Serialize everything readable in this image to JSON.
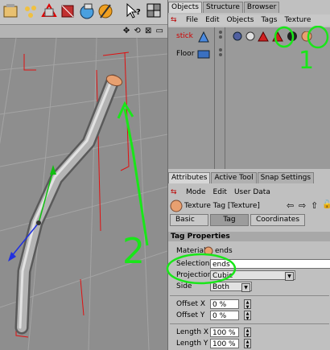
{
  "objects_panel": {
    "tabs": [
      "Objects",
      "Structure",
      "Browser"
    ],
    "menu": [
      "File",
      "Edit",
      "Objects",
      "Tags",
      "Texture"
    ],
    "items": [
      {
        "name": "stick"
      },
      {
        "name": "Floor"
      }
    ]
  },
  "attributes_panel": {
    "tabs": [
      "Attributes",
      "Active Tool",
      "Snap Settings"
    ],
    "menu": [
      "Mode",
      "Edit",
      "User Data"
    ],
    "title": "Texture Tag [Texture]",
    "subtabs": [
      "Basic",
      "Tag",
      "Coordinates"
    ],
    "section": "Tag Properties",
    "fields": {
      "material_label": "Material",
      "material_value": "ends",
      "selection_label": "Selection",
      "selection_value": "ends",
      "projection_label": "Projection",
      "projection_value": "Cubic",
      "side_label": "Side",
      "side_value": "Both",
      "offset_x_label": "Offset X",
      "offset_x_value": "0 %",
      "offset_y_label": "Offset Y",
      "offset_y_value": "0 %",
      "length_x_label": "Length X",
      "length_x_value": "100 %",
      "length_y_label": "Length Y",
      "length_y_value": "100 %"
    }
  },
  "annotations": {
    "num1": "1",
    "num2": "2"
  },
  "colors": {
    "annotation": "#19e619",
    "stick_label": "#d00000",
    "highlight": "#ff0000"
  }
}
